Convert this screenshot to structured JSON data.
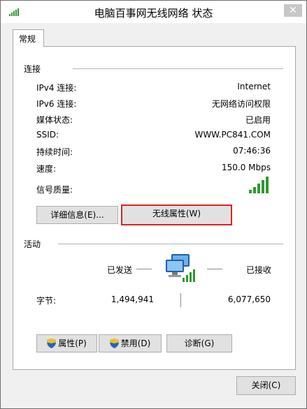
{
  "window": {
    "title": "电脑百事网无线网络 状态",
    "close_glyph": "✕"
  },
  "tabs": [
    {
      "label": "常规"
    }
  ],
  "connection": {
    "section_label": "连接",
    "rows": [
      {
        "label": "IPv4 连接:",
        "value": "Internet"
      },
      {
        "label": "IPv6 连接:",
        "value": "无网络访问权限"
      },
      {
        "label": "媒体状态:",
        "value": "已启用"
      },
      {
        "label": "SSID:",
        "value": "WWW.PC841.COM"
      },
      {
        "label": "持续时间:",
        "value": "07:46:36"
      },
      {
        "label": "速度:",
        "value": "150.0 Mbps"
      },
      {
        "label": "信号质量:",
        "value_icon": "signal-bars-icon",
        "signal_bars": 5
      }
    ],
    "details_button": "详细信息(E)...",
    "wireless_props_button": "无线属性(W)"
  },
  "activity": {
    "section_label": "活动",
    "sent_label": "已发送",
    "received_label": "已接收",
    "bytes_label": "字节:",
    "bytes_sent": "1,494,941",
    "bytes_received": "6,077,650",
    "network_icon": "network-computers-icon"
  },
  "buttons": {
    "properties": "属性(P)",
    "disable": "禁用(D)",
    "diagnose": "诊断(G)",
    "close": "关闭(C)"
  },
  "colors": {
    "highlight_border": "#d72424",
    "signal_green": "#2e9a2e"
  }
}
